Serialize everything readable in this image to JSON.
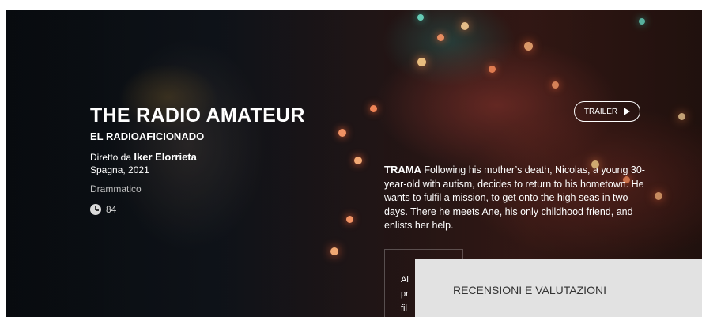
{
  "movie": {
    "title": "THE RADIO AMATEUR",
    "original_title": "EL RADIOAFICIONADO",
    "director_prefix": "Diretto da",
    "director_name": "Iker Elorrieta",
    "country_year": "Spagna, 2021",
    "genre": "Drammatico",
    "duration": "84"
  },
  "trailer": {
    "label": "TRAILER"
  },
  "plot": {
    "label": "TRAMA",
    "text": "Following his mother’s death, Nicolas, a young 30-year-old with autism, decides to return to his hometown. He wants to fulfil a mission, to get onto the high seas in two days. There he meets Ane, his only childhood friend, and enlists her help."
  },
  "reviews_snippet": {
    "line1": "Al",
    "line2": "pr",
    "line3": "fil"
  },
  "reviews_panel": {
    "label": "RECENSIONI E VALUTAZIONI"
  },
  "icons": {
    "clock": "clock-icon",
    "play": "play-icon"
  }
}
